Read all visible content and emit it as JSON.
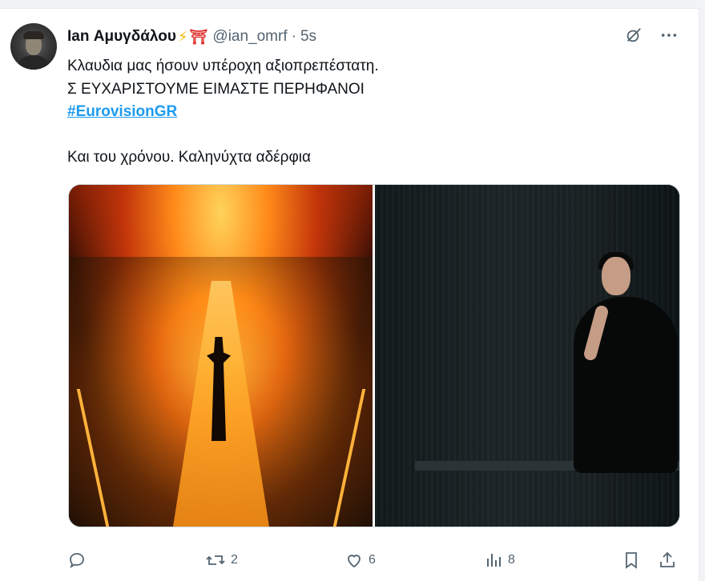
{
  "tweet": {
    "author_name": "Ian Αμυγδάλου",
    "emoji_1": "⚡",
    "emoji_2": "⛩",
    "handle": "@ian_omrf",
    "separator": "·",
    "time": "5s",
    "text_lines": [
      "Κλαυδια μας ήσουν υπέροχη αξιοπρεπέστατη.",
      "Σ ΕΥΧΑΡΙΣΤΟΥΜΕ ΕΙΜΑΣΤΕ ΠΕΡΗΦΑΝΟΙ"
    ],
    "hashtag": "#EurovisionGR",
    "text_after": "Και του χρόνου. Καληνύχτα αδέρφια"
  },
  "header_icons": {
    "grok": "grok-icon",
    "more": "more-icon"
  },
  "actions": {
    "reply": {
      "icon": "reply-icon",
      "count": ""
    },
    "retweet": {
      "icon": "retweet-icon",
      "count": "2"
    },
    "like": {
      "icon": "heart-icon",
      "count": "6"
    },
    "views": {
      "icon": "views-icon",
      "count": "8"
    },
    "bookmark": {
      "icon": "bookmark-icon"
    },
    "share": {
      "icon": "share-icon"
    }
  },
  "colors": {
    "text": "#0f1419",
    "secondary": "#536471",
    "link": "#1d9bf0"
  }
}
